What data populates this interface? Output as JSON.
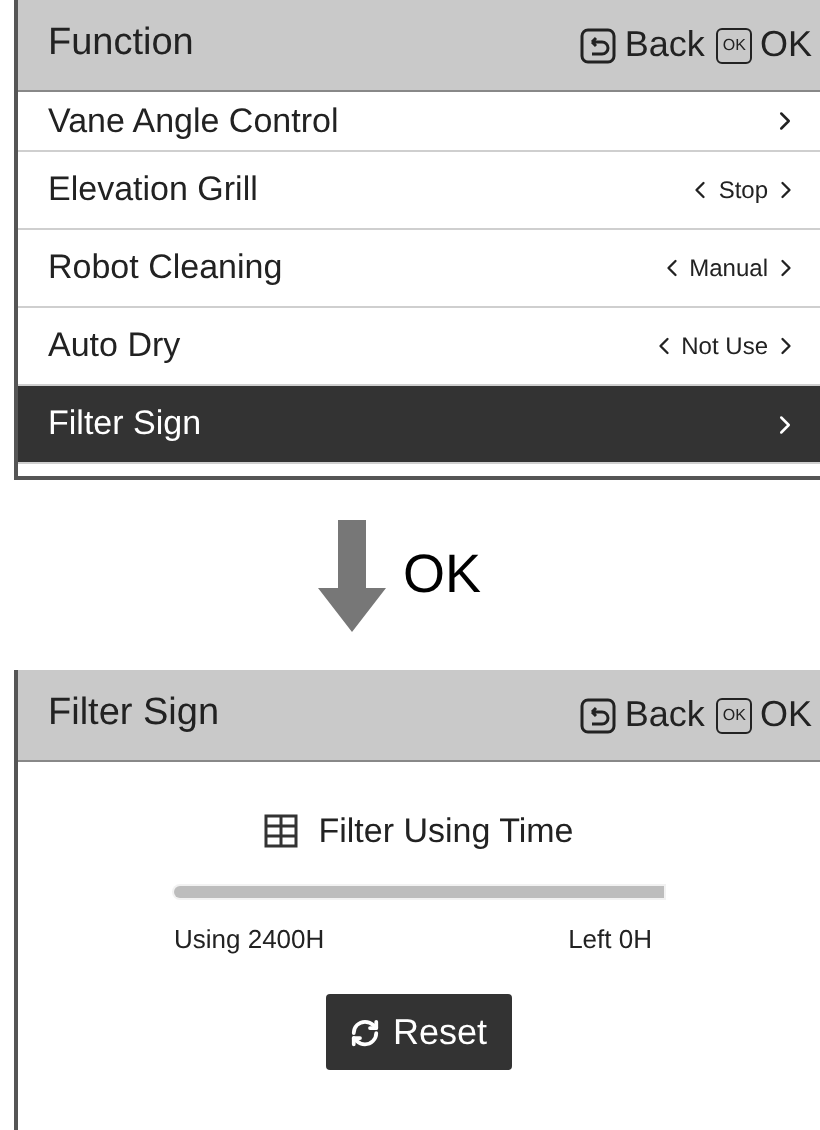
{
  "function_screen": {
    "title": "Function",
    "back_label": "Back",
    "ok_key": "OK",
    "ok_label": "OK",
    "items": [
      {
        "label": "Vane Angle Control",
        "kind": "submenu",
        "selected": false
      },
      {
        "label": "Elevation Grill",
        "kind": "option",
        "value": "Stop",
        "selected": false
      },
      {
        "label": "Robot Cleaning",
        "kind": "option",
        "value": "Manual",
        "selected": false
      },
      {
        "label": "Auto Dry",
        "kind": "option",
        "value": "Not Use",
        "selected": false
      },
      {
        "label": "Filter Sign",
        "kind": "submenu",
        "selected": true
      }
    ]
  },
  "transition": {
    "label": "OK"
  },
  "filter_screen": {
    "title": "Filter Sign",
    "back_label": "Back",
    "ok_key": "OK",
    "ok_label": "OK",
    "heading": "Filter Using Time",
    "progress": {
      "level": 1
    },
    "using": "Using 2400H",
    "left": "Left 0H",
    "reset_label": "Reset"
  }
}
